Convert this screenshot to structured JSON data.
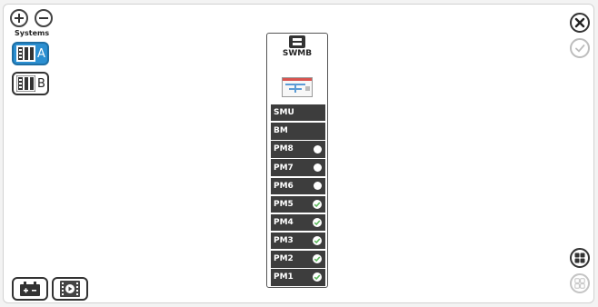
{
  "sidebar": {
    "systems_label": "Systems",
    "systems": [
      {
        "letter": "A",
        "selected": true,
        "icon": "rack-icon"
      },
      {
        "letter": "B",
        "selected": false,
        "icon": "rack-icon"
      }
    ]
  },
  "module": {
    "title": "SWMB",
    "logo_icon": "cummins-logo-icon",
    "diagram_icon": "schematic-icon",
    "slots": [
      {
        "label": "SMU",
        "status": "none"
      },
      {
        "label": "BM",
        "status": "none"
      },
      {
        "label": "PM8",
        "status": "empty"
      },
      {
        "label": "PM7",
        "status": "empty"
      },
      {
        "label": "PM6",
        "status": "empty"
      },
      {
        "label": "PM5",
        "status": "ok"
      },
      {
        "label": "PM4",
        "status": "ok"
      },
      {
        "label": "PM3",
        "status": "ok"
      },
      {
        "label": "PM2",
        "status": "ok"
      },
      {
        "label": "PM1",
        "status": "ok"
      }
    ]
  },
  "colors": {
    "accent": "#2b8fd1",
    "slot_bg": "#3d3d3d",
    "ok_green": "#5cb85c"
  },
  "toolbar": {
    "top_left": [
      "add-icon",
      "remove-icon"
    ],
    "top_right": [
      "close-icon",
      "confirm-icon"
    ],
    "bottom_left": [
      "battery-icon",
      "media-icon"
    ],
    "bottom_right": [
      "grid-view-icon",
      "grid-view-outline-icon"
    ]
  }
}
